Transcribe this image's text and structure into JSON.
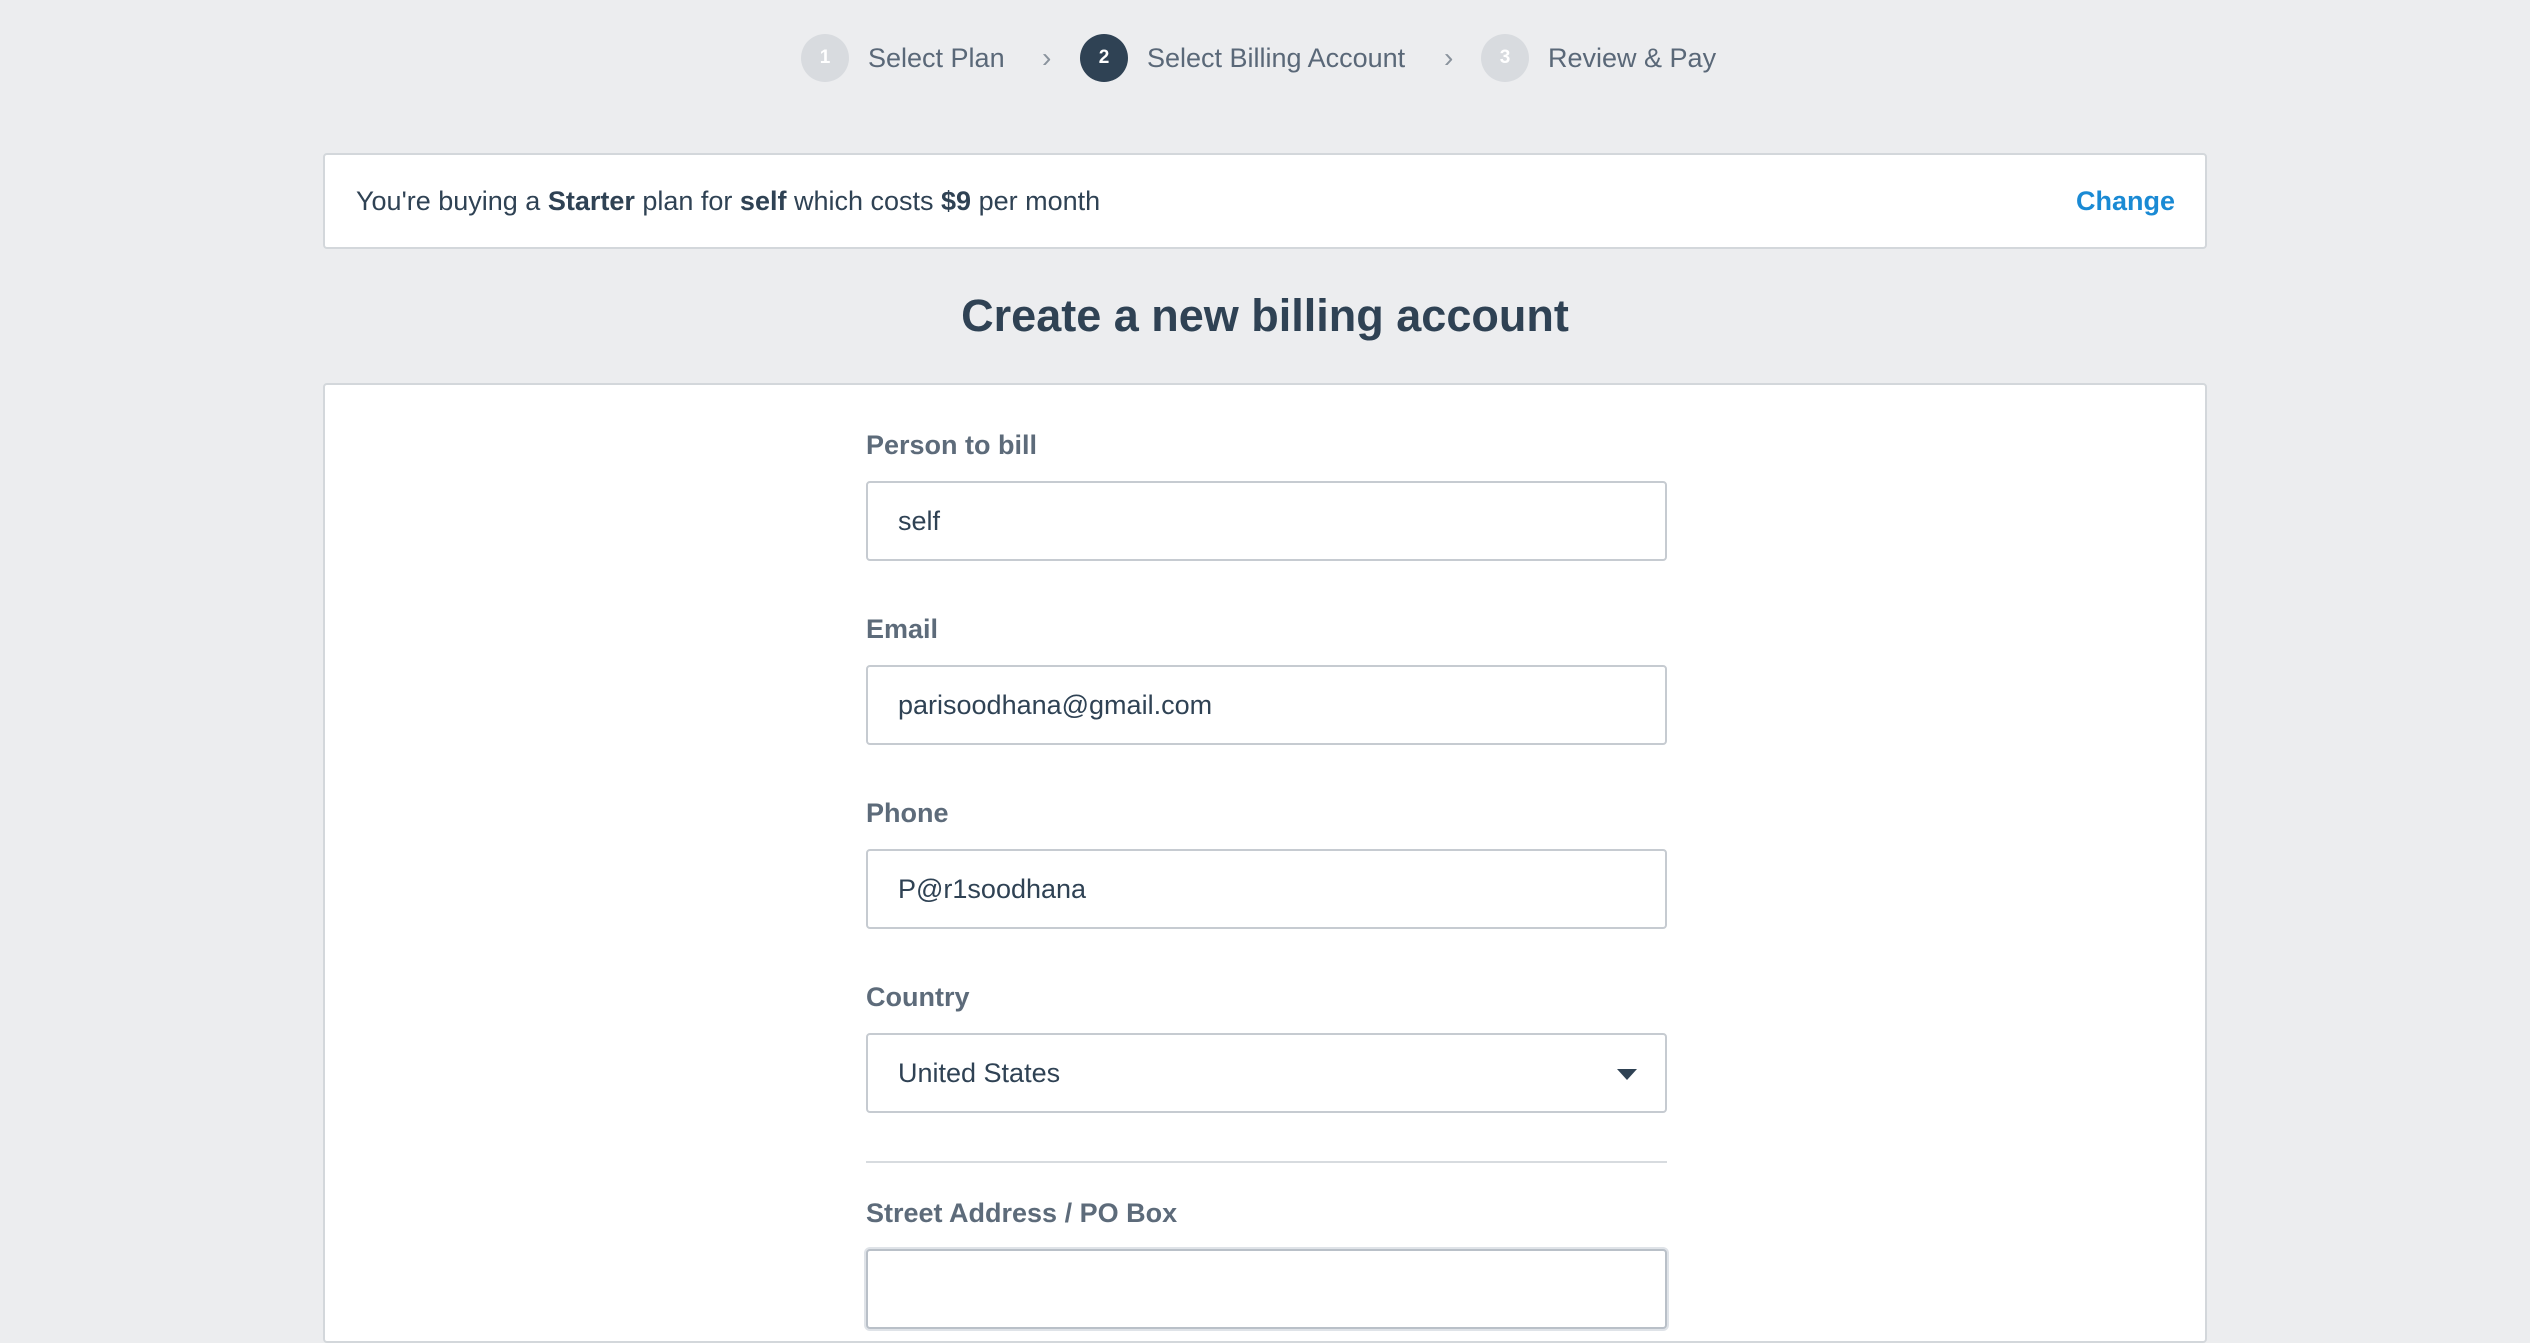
{
  "stepper": {
    "steps": [
      {
        "number": "1",
        "label": "Select Plan",
        "state": "inactive"
      },
      {
        "number": "2",
        "label": "Select Billing Account",
        "state": "active"
      },
      {
        "number": "3",
        "label": "Review & Pay",
        "state": "inactive"
      }
    ],
    "separator": "›"
  },
  "summary": {
    "prefix": "You're buying a ",
    "plan": "Starter",
    "middle1": " plan for ",
    "person": "self",
    "middle2": " which costs ",
    "price": "$9",
    "suffix": " per month",
    "change_label": "Change"
  },
  "heading": "Create a new billing account",
  "form": {
    "person_to_bill": {
      "label": "Person to bill",
      "value": "self"
    },
    "email": {
      "label": "Email",
      "value": "parisoodhana@gmail.com"
    },
    "phone": {
      "label": "Phone",
      "value": "P@r1soodhana"
    },
    "country": {
      "label": "Country",
      "value": "United States"
    },
    "street": {
      "label": "Street Address / PO Box",
      "value": ""
    }
  },
  "colors": {
    "background": "#ecedef",
    "text": "#2f4254",
    "link": "#1a8ad4",
    "step_active": "#2f4254",
    "step_inactive": "#d8dbdf"
  }
}
